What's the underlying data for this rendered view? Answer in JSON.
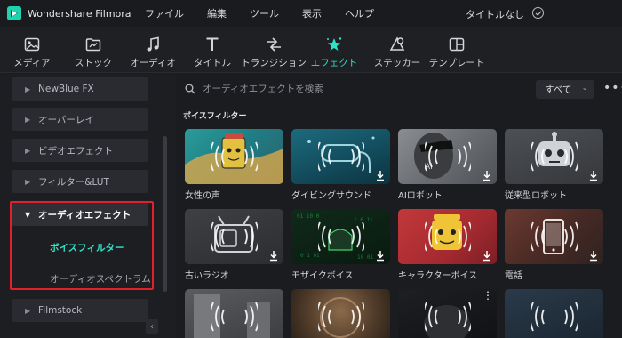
{
  "app": {
    "name": "Wondershare Filmora",
    "project_title": "タイトルなし"
  },
  "menu": [
    "ファイル",
    "編集",
    "ツール",
    "表示",
    "ヘルプ"
  ],
  "toolbar": [
    {
      "label": "メディア",
      "icon": "media-icon"
    },
    {
      "label": "ストック",
      "icon": "stock-icon"
    },
    {
      "label": "オーディオ",
      "icon": "music-note-icon"
    },
    {
      "label": "タイトル",
      "icon": "title-t-icon"
    },
    {
      "label": "トランジション",
      "icon": "transition-arrows-icon"
    },
    {
      "label": "エフェクト",
      "icon": "effects-star-icon",
      "active": true
    },
    {
      "label": "ステッカー",
      "icon": "sticker-icon"
    },
    {
      "label": "テンプレート",
      "icon": "template-icon"
    }
  ],
  "sidebar": {
    "items": [
      {
        "label": "NewBlue FX"
      },
      {
        "label": "オーバーレイ"
      },
      {
        "label": "ビデオエフェクト"
      },
      {
        "label": "フィルター&LUT"
      },
      {
        "label": "オーディオエフェクト",
        "expanded": true
      },
      {
        "label": "Filmstock"
      }
    ],
    "sub_items": [
      "ボイスフィルター",
      "オーディオスペクトラム"
    ],
    "active_sub": "ボイスフィルター"
  },
  "search": {
    "placeholder": "オーディオエフェクトを検索"
  },
  "filter": {
    "value": "すべて"
  },
  "section": {
    "title": "ボイスフィルター"
  },
  "cards": [
    {
      "label": "女性の声"
    },
    {
      "label": "ダイビングサウンド"
    },
    {
      "label": "AIロボット"
    },
    {
      "label": "従来型ロボット"
    },
    {
      "label": "古いラジオ"
    },
    {
      "label": "モザイクボイス"
    },
    {
      "label": "キャラクターボイス"
    },
    {
      "label": "電話"
    },
    {
      "label": ""
    },
    {
      "label": ""
    },
    {
      "label": ""
    },
    {
      "label": ""
    }
  ],
  "colors": {
    "accent": "#2fe3c9",
    "highlight_box": "#e0202a"
  }
}
